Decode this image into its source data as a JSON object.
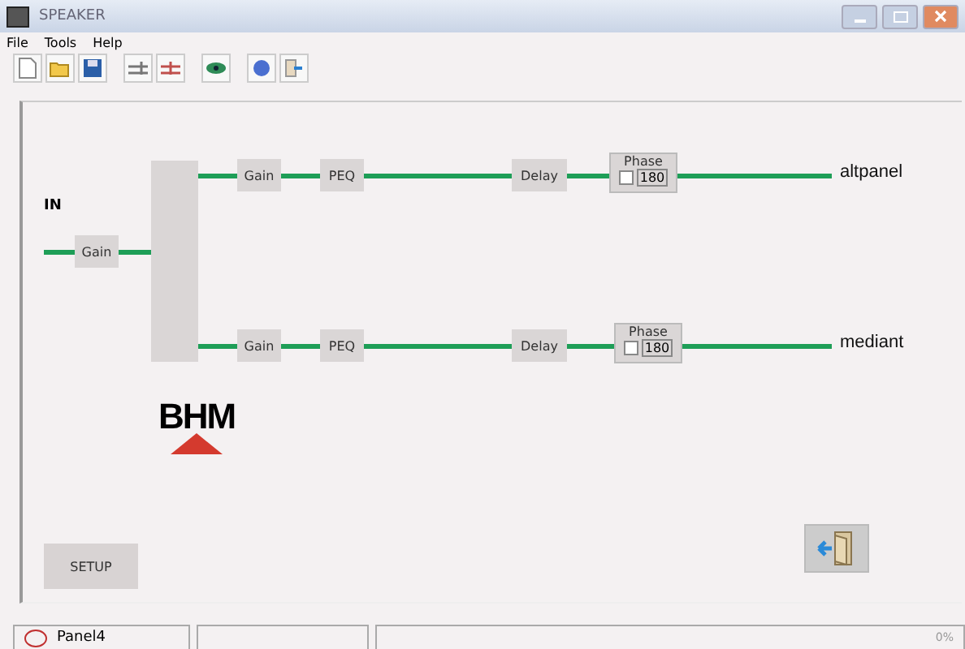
{
  "window": {
    "title": "SPEAKER"
  },
  "menu": [
    "File",
    "Tools",
    "Help"
  ],
  "diagram": {
    "input_label": "IN",
    "input_block": "Gain",
    "branches": [
      {
        "output": "altpanel",
        "blocks": [
          {
            "kind": "block",
            "label": "Gain"
          },
          {
            "kind": "block",
            "label": "PEQ"
          },
          {
            "kind": "block",
            "label": "Delay"
          },
          {
            "kind": "phase",
            "label": "Phase",
            "option": "180",
            "checked": false
          }
        ]
      },
      {
        "output": "mediant",
        "blocks": [
          {
            "kind": "block",
            "label": "Gain"
          },
          {
            "kind": "block",
            "label": "PEQ"
          },
          {
            "kind": "block",
            "label": "Delay"
          },
          {
            "kind": "phase",
            "label": "Phase",
            "option": "180",
            "checked": false
          }
        ]
      }
    ],
    "logo": "BHM"
  },
  "setup_button": "SETUP",
  "status_bar": {
    "panel": "Panel4",
    "progress": "0%"
  }
}
